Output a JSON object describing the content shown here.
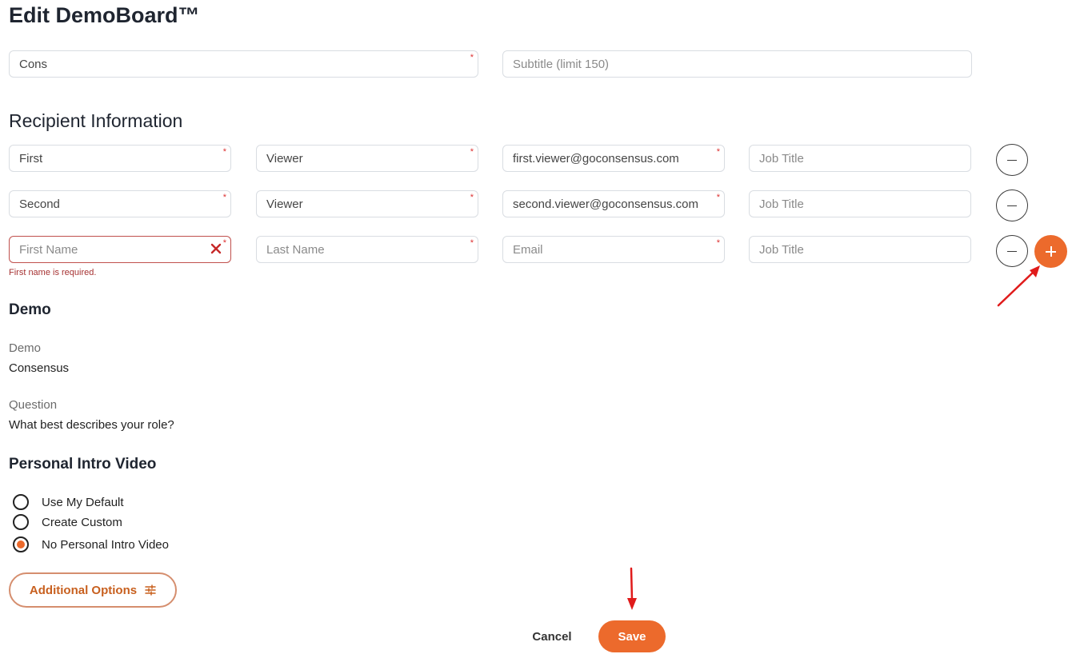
{
  "page": {
    "title": "Edit DemoBoard™"
  },
  "board": {
    "title_value": "Cons",
    "title_required": "*",
    "subtitle_placeholder": "Subtitle (limit 150)"
  },
  "recipients": {
    "heading": "Recipient Information",
    "required_mark": "*",
    "rows": [
      {
        "first": "First",
        "last": "Viewer",
        "email": "first.viewer@goconsensus.com",
        "job_placeholder": "Job Title"
      },
      {
        "first": "Second",
        "last": "Viewer",
        "email": "second.viewer@goconsensus.com",
        "job_placeholder": "Job Title"
      },
      {
        "first": "",
        "first_placeholder": "First Name",
        "last": "",
        "last_placeholder": "Last Name",
        "email": "",
        "email_placeholder": "Email",
        "job_placeholder": "Job Title",
        "error": "First name is required."
      }
    ]
  },
  "demo": {
    "heading": "Demo",
    "demo_label": "Demo",
    "demo_value": "Consensus",
    "question_label": "Question",
    "question_value": "What best describes your role?"
  },
  "intro_video": {
    "heading": "Personal Intro Video",
    "options": [
      "Use My Default",
      "Create Custom",
      "No Personal Intro Video"
    ],
    "selected": "No Personal Intro Video"
  },
  "actions": {
    "additional_options": "Additional Options",
    "cancel": "Cancel",
    "save": "Save"
  },
  "colors": {
    "accent": "#ec6a2c",
    "error": "#a63232",
    "annotation_arrow": "#e01b1b"
  }
}
